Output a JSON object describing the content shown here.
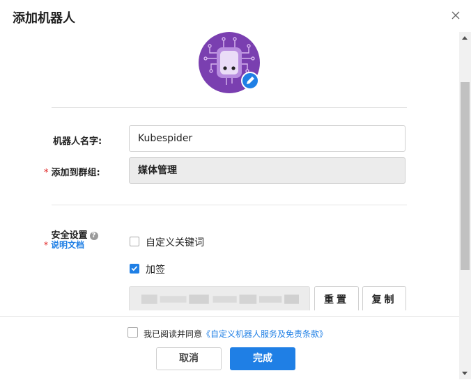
{
  "dialog": {
    "title": "添加机器人"
  },
  "form": {
    "name_label": "机器人名字:",
    "name_value": "Kubespider",
    "group_required": "*",
    "group_label": "添加到群组:",
    "group_value": "媒体管理",
    "security_required": "*",
    "security_label": "安全设置",
    "security_help_icon": "?",
    "docs_link": "说明文档",
    "keyword_label": "自定义关键词",
    "keyword_checked": false,
    "sign_label": "加签",
    "sign_checked": true,
    "reset_label": "重置",
    "copy_label": "复制"
  },
  "footer": {
    "agree_prefix": "我已阅读并同意",
    "agree_link": "《自定义机器人服务及免责条款》",
    "cancel_label": "取消",
    "done_label": "完成"
  },
  "colors": {
    "accent": "#1f7fe5",
    "avatar_bg": "#7a3fb0",
    "required": "#e02020"
  }
}
